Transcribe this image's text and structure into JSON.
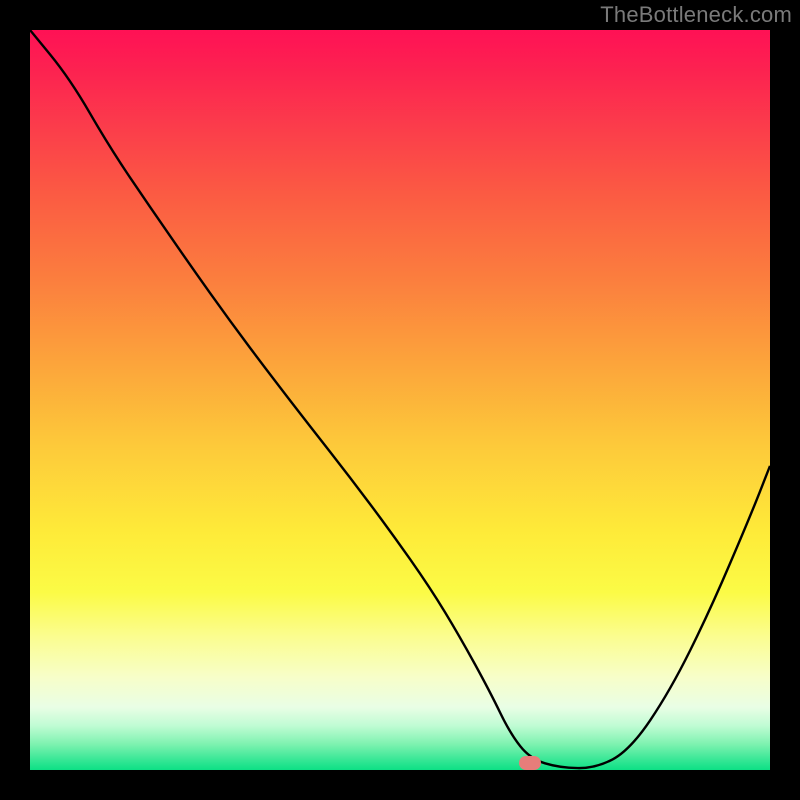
{
  "watermark": "TheBottleneck.com",
  "colors": {
    "marker": "#e77d7a",
    "curve_stroke": "#000000",
    "background": "#000000"
  },
  "chart_data": {
    "type": "line",
    "title": "",
    "xlabel": "",
    "ylabel": "",
    "xlim_pct": [
      0,
      100
    ],
    "ylim_pct": [
      0,
      100
    ],
    "series": [
      {
        "name": "bottleneck-curve",
        "x_pct": [
          0.0,
          5.4,
          10.8,
          16.2,
          21.6,
          27.0,
          32.4,
          37.8,
          43.2,
          48.6,
          54.1,
          58.1,
          62.2,
          64.9,
          67.6,
          71.6,
          76.4,
          81.1,
          86.5,
          91.9,
          97.3,
          100.0
        ],
        "y_pct": [
          100.0,
          93.4,
          84.1,
          76.1,
          68.3,
          60.7,
          53.5,
          46.5,
          39.6,
          32.4,
          24.6,
          18.0,
          10.5,
          4.9,
          1.5,
          0.3,
          0.2,
          2.7,
          10.7,
          21.6,
          34.2,
          41.1
        ]
      }
    ],
    "marker": {
      "x_pct": 67.6,
      "y_pct": 0.9
    },
    "flat_bottom_range_pct": [
      62.2,
      78.4
    ]
  }
}
